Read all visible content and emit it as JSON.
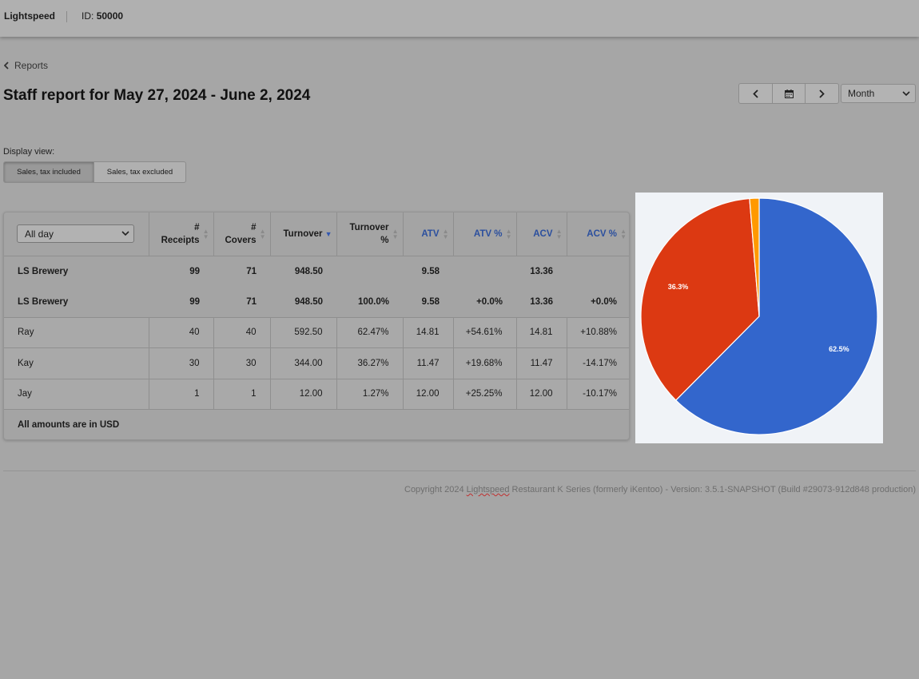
{
  "header": {
    "brand": "Lightspeed",
    "id_label": "ID:",
    "id_value": "50000"
  },
  "nav": {
    "back_label": "Reports"
  },
  "page": {
    "title": "Staff report for May 27, 2024 - June 2, 2024"
  },
  "period": {
    "selected": "Month"
  },
  "display_view": {
    "label": "Display view:",
    "options": [
      "Sales, tax included",
      "Sales, tax excluded"
    ],
    "active": "Sales, tax included"
  },
  "table": {
    "shift_filter": "All day",
    "columns": [
      {
        "line1": "#",
        "line2": "Receipts"
      },
      {
        "line1": "#",
        "line2": "Covers"
      },
      {
        "line1": "Turnover",
        "line2": ""
      },
      {
        "line1": "Turnover",
        "line2": "%"
      },
      {
        "line1": "ATV",
        "line2": ""
      },
      {
        "line1": "ATV %",
        "line2": ""
      },
      {
        "line1": "ACV",
        "line2": ""
      },
      {
        "line1": "ACV %",
        "line2": ""
      }
    ],
    "summary_row": {
      "name": "LS Brewery",
      "receipts": "99",
      "covers": "71",
      "turnover": "948.50",
      "turnover_pct": "",
      "atv": "9.58",
      "atv_pct": "",
      "acv": "13.36",
      "acv_pct": ""
    },
    "total_row": {
      "name": "LS Brewery",
      "receipts": "99",
      "covers": "71",
      "turnover": "948.50",
      "turnover_pct": "100.0%",
      "atv": "9.58",
      "atv_pct": "+0.0%",
      "acv": "13.36",
      "acv_pct": "+0.0%"
    },
    "staff_rows": [
      {
        "name": "Ray",
        "receipts": "40",
        "covers": "40",
        "turnover": "592.50",
        "turnover_pct": "62.47%",
        "atv": "14.81",
        "atv_pct": "+54.61%",
        "acv": "14.81",
        "acv_pct": "+10.88%"
      },
      {
        "name": "Kay",
        "receipts": "30",
        "covers": "30",
        "turnover": "344.00",
        "turnover_pct": "36.27%",
        "atv": "11.47",
        "atv_pct": "+19.68%",
        "acv": "11.47",
        "acv_pct": "-14.17%"
      },
      {
        "name": "Jay",
        "receipts": "1",
        "covers": "1",
        "turnover": "12.00",
        "turnover_pct": "1.27%",
        "atv": "12.00",
        "atv_pct": "+25.25%",
        "acv": "12.00",
        "acv_pct": "-10.17%"
      }
    ],
    "footer_note": "All amounts are in USD"
  },
  "chart_data": {
    "type": "pie",
    "categories": [
      "Ray",
      "Kay",
      "Jay"
    ],
    "values": [
      62.5,
      36.3,
      1.3
    ],
    "labels": [
      "62.5%",
      "36.3%",
      ""
    ],
    "colors": [
      "#3366cc",
      "#dc3912",
      "#ff9900"
    ]
  },
  "footer": {
    "copyright_before": "Copyright 2024 ",
    "copyright_brand": "Lightspeed",
    "copyright_after": " Restaurant K Series (formerly iKentoo) - Version: 3.5.1-SNAPSHOT (Build #29073-912d848 production)"
  }
}
